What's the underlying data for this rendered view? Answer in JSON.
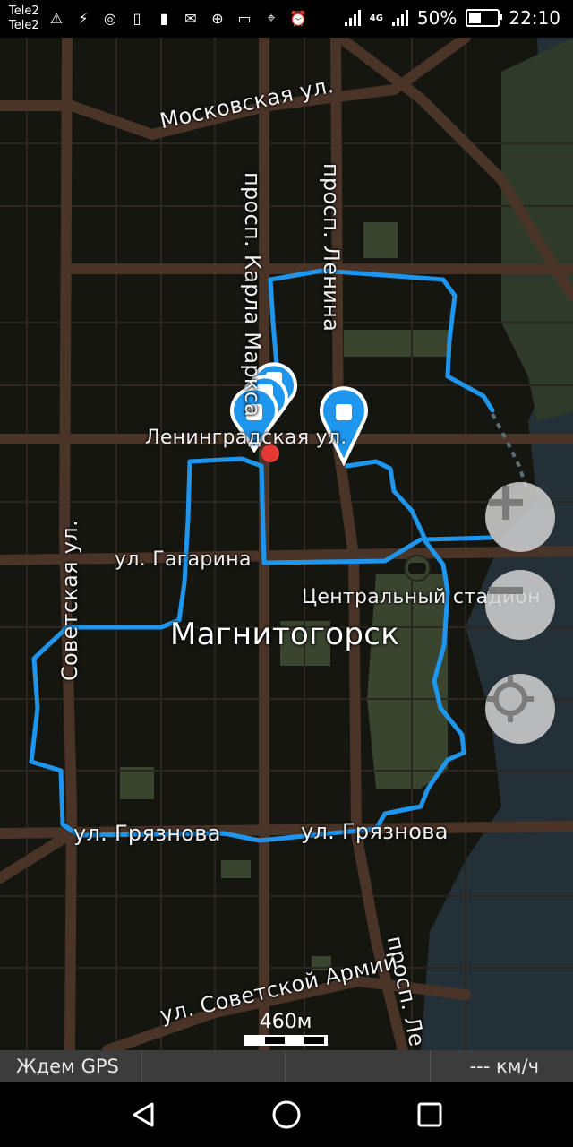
{
  "status_bar": {
    "carrier_1": "Tele2",
    "carrier_2": "Tele2",
    "network": "4G",
    "battery": "50%",
    "battery_level": 0.5,
    "time": "22:10",
    "icons": [
      "warning-icon",
      "running-icon",
      "location-target-icon",
      "battery-saver-icon",
      "sd-card-icon",
      "mail-off-icon",
      "data-saver-icon",
      "cast-icon",
      "location-pin-icon",
      "alarm-icon"
    ]
  },
  "map": {
    "streets": {
      "moskovskaya": "Московская ул.",
      "karla_marksa": "просп. Карла Маркса",
      "lenina": "просп. Ленина",
      "lenina_lower": "просп. Ле",
      "leningradskaya": "Ленинградская ул.",
      "gagarina": "ул. Гагарина",
      "sovetskaya": "Советская ул.",
      "gryaznova_1": "ул. Грязнова",
      "gryaznova_2": "ул. Грязнова",
      "sovetskoy_armii": "ул. Советской Армии"
    },
    "city_label": "Магнитогорск",
    "poi_stadium": "Центральный стадион",
    "scale_label": "460м",
    "colors": {
      "track": "#1e96ee",
      "road": "#4a3428",
      "water": "#243038",
      "park": "#3a4530",
      "marker": "#1e96ee"
    }
  },
  "controls": {
    "zoom_in": "+",
    "zoom_out": "−",
    "locate": "locate-icon"
  },
  "gps_bar": {
    "status": "Ждем GPS",
    "speed": "--- км/ч"
  },
  "nav_bar": {
    "back": "back-icon",
    "home": "home-icon",
    "recents": "recents-icon"
  }
}
